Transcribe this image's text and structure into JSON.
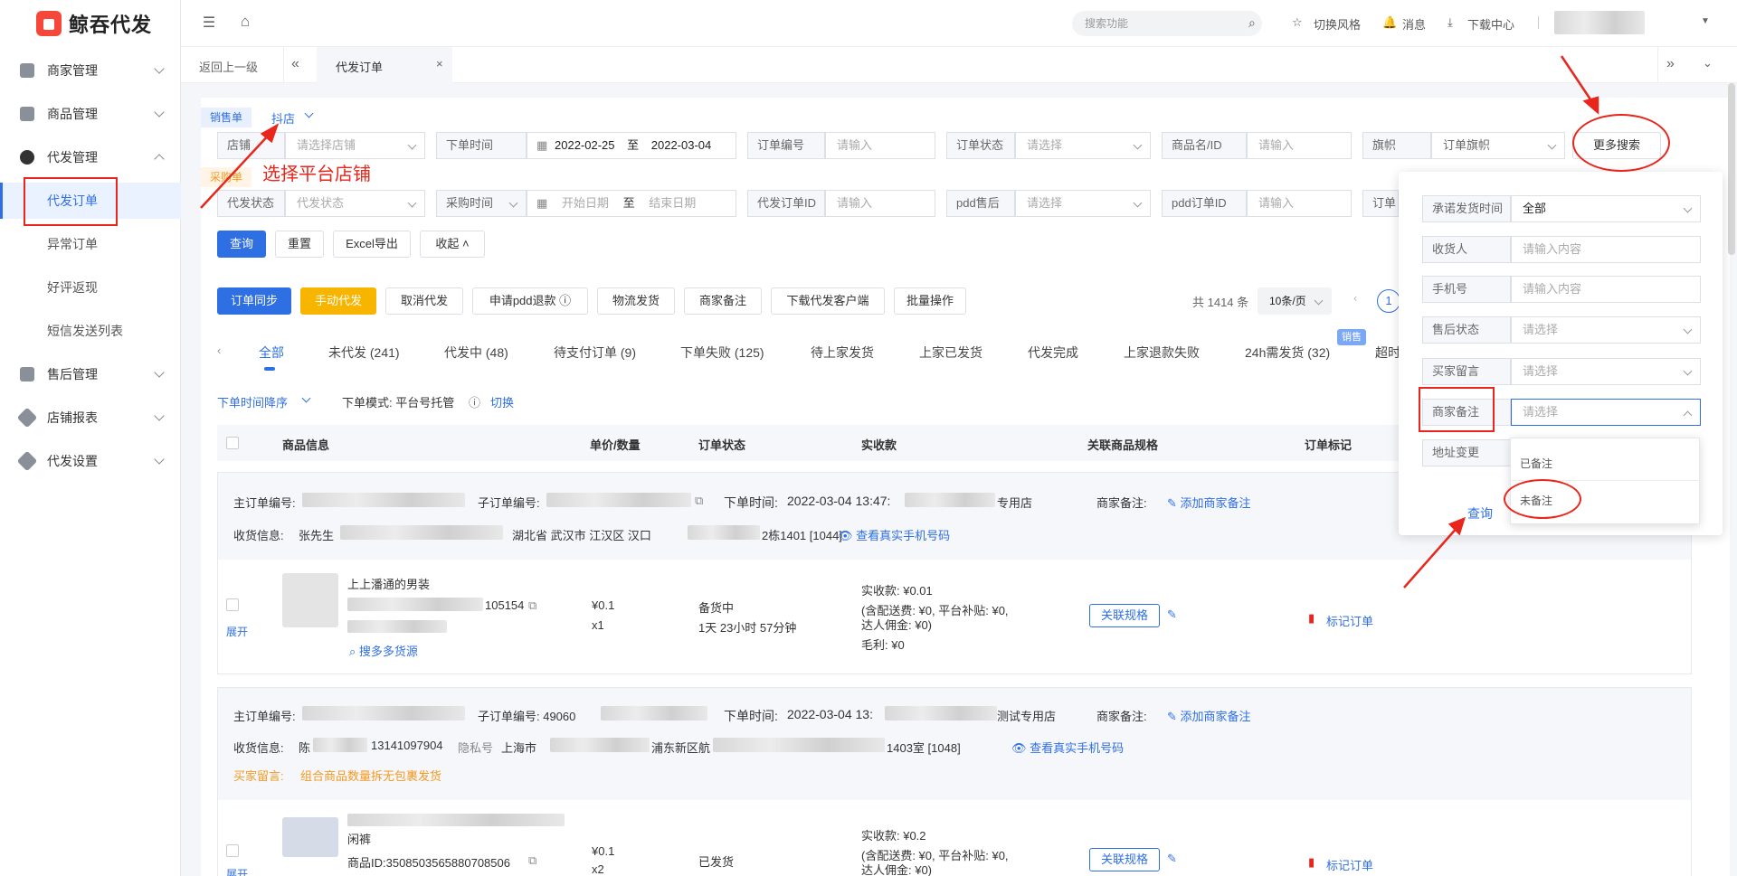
{
  "app": {
    "name": "鲸吞代发"
  },
  "sidebar": {
    "items": [
      {
        "label": "商家管理"
      },
      {
        "label": "商品管理"
      },
      {
        "label": "代发管理"
      },
      {
        "label": "售后管理"
      },
      {
        "label": "店铺报表"
      },
      {
        "label": "代发设置"
      }
    ],
    "sub_items": [
      {
        "label": "代发订单"
      },
      {
        "label": "异常订单"
      },
      {
        "label": "好评返现"
      },
      {
        "label": "短信发送列表"
      }
    ]
  },
  "topbar": {
    "search_placeholder": "搜索功能",
    "switch_style": "切换风格",
    "messages": "消息",
    "downloads": "下载中心"
  },
  "tabs": {
    "back": "返回上一级",
    "current": "代发订单"
  },
  "filters": {
    "sale_tag": "销售单",
    "platform": "抖店",
    "purchase_tag": "采购单",
    "shop_label": "店铺",
    "shop_placeholder": "请选择店铺",
    "order_time_label": "下单时间",
    "date_from": "2022-02-25",
    "date_to_sep": "至",
    "date_to": "2022-03-04",
    "order_no_label": "订单编号",
    "input_placeholder": "请输入",
    "order_status_label": "订单状态",
    "select_placeholder": "请选择",
    "product_label": "商品名/ID",
    "flag_label": "旗帜",
    "flag_placeholder": "订单旗帜",
    "more_search": "更多搜索",
    "dropship_status_label": "代发状态",
    "dropship_status_placeholder": "代发状态",
    "purchase_time_label": "采购时间",
    "start_date": "开始日期",
    "end_date": "结束日期",
    "dropship_id_label": "代发订单ID",
    "pdd_after_label": "pdd售后",
    "pdd_order_label": "pdd订单ID",
    "order_cut": "订单"
  },
  "actions": {
    "query": "查询",
    "reset": "重置",
    "export": "Excel导出",
    "collapse": "收起"
  },
  "toolbar": {
    "sync": "订单同步",
    "manual": "手动代发",
    "cancel": "取消代发",
    "refund": "申请pdd退款",
    "logistics": "物流发货",
    "merchant_note": "商家备注",
    "download_client": "下载代发客户端",
    "batch": "批量操作",
    "total": "共 1414 条",
    "page_size": "10条/页",
    "page": "1"
  },
  "status_tabs": [
    {
      "label": "全部"
    },
    {
      "label": "未代发 (241)"
    },
    {
      "label": "代发中 (48)"
    },
    {
      "label": "待支付订单 (9)"
    },
    {
      "label": "下单失败 (125)"
    },
    {
      "label": "待上家发货"
    },
    {
      "label": "上家已发货"
    },
    {
      "label": "代发完成"
    },
    {
      "label": "上家退款失败"
    },
    {
      "label": "24h需发货 (32)"
    },
    {
      "label": "超时"
    }
  ],
  "sale_badge": "销售",
  "sort": {
    "label": "下单时间降序",
    "mode": "下单模式: 平台号托管",
    "switch": "切换"
  },
  "table_headers": [
    "商品信息",
    "单价/数量",
    "订单状态",
    "实收款",
    "关联商品规格",
    "订单标记"
  ],
  "orders": [
    {
      "main_label": "主订单编号:",
      "sub_label": "子订单编号:",
      "time_label": "下单时间:",
      "time": "2022-03-04 13:47:",
      "shop_suffix": "专用店",
      "note_label": "商家备注:",
      "add_note": "添加商家备注",
      "receiver_label": "收货信息:",
      "receiver_name": "张先生",
      "address": "湖北省 武汉市 江汉区 汉口",
      "address_tail": "2栋1401 [1044]",
      "view_phone": "查看真实手机号码",
      "product_title": "上上潘通的男装",
      "product_id": "105154",
      "expand": "展开",
      "search_source": "搜多多货源",
      "price": "¥0.1",
      "qty": "x1",
      "status": "备货中",
      "countdown": "1天 23小时 57分钟",
      "received": "实收款: ¥0.01",
      "fees1": "(含配送费: ¥0, 平台补贴: ¥0,",
      "fees2": "达人佣金: ¥0)",
      "margin": "毛利: ¥0",
      "link_spec": "关联规格",
      "mark": "标记订单"
    },
    {
      "main_label": "主订单编号:",
      "sub_label": "子订单编号: 49060",
      "time_label": "下单时间:",
      "time": "2022-03-04 13:",
      "shop_suffix": "测试专用店",
      "note_label": "商家备注:",
      "add_note": "添加商家备注",
      "receiver_label": "收货信息:",
      "receiver_name": "陈",
      "phone": "13141097904",
      "private": "隐私号",
      "address": "上海市",
      "address_mid": "浦东新区航",
      "address_tail": "1403室 [1048]",
      "view_phone": "查看真实手机号码",
      "buyer_msg_label": "买家留言:",
      "buyer_msg": "组合商品数量拆无包裹发货",
      "product_title": "闲裤",
      "product_id": "商品ID:3508503565880708506",
      "expand": "展开",
      "price": "¥0.1",
      "qty": "x2",
      "status": "已发货",
      "received": "实收款: ¥0.2",
      "fees1": "(含配送费: ¥0, 平台补贴: ¥0,",
      "fees2": "达人佣金: ¥0)",
      "link_spec": "关联规格",
      "mark": "标记订单"
    }
  ],
  "more_panel": {
    "rows": [
      {
        "label": "承诺发货时间",
        "value": "全部"
      },
      {
        "label": "收货人",
        "value": "请输入内容"
      },
      {
        "label": "手机号",
        "value": "请输入内容"
      },
      {
        "label": "售后状态",
        "value": "请选择"
      },
      {
        "label": "买家留言",
        "value": "请选择"
      },
      {
        "label": "商家备注",
        "value": "请选择"
      },
      {
        "label": "地址变更",
        "value": ""
      }
    ],
    "options": [
      "已备注",
      "未备注"
    ],
    "query": "查询"
  },
  "annotation": {
    "select_platform": "选择平台店铺"
  },
  "colors": {
    "primary": "#2f6fe4",
    "warning": "#f7b500",
    "annotation": "#e8261c",
    "logo": "#f5483b"
  }
}
